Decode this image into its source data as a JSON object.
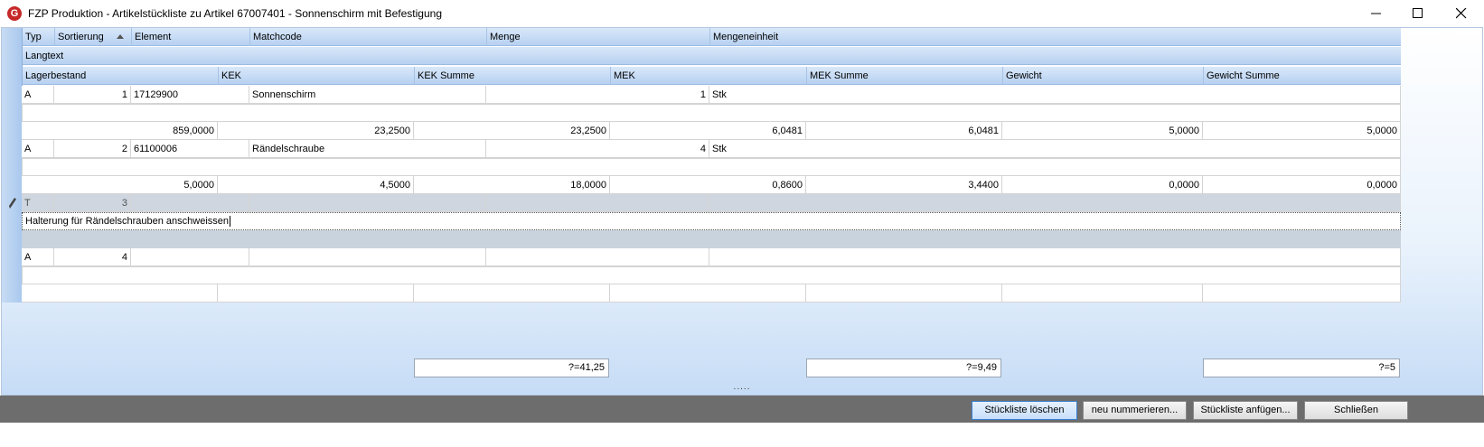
{
  "window": {
    "title": "FZP Produktion - Artikelstückliste zu Artikel 67007401  -  Sonnenschirm mit Befestigung",
    "icon_letter": "G"
  },
  "grid": {
    "header_row1": [
      "Typ",
      "Sortierung",
      "Element",
      "Matchcode",
      "Menge",
      "Mengeneinheit"
    ],
    "header_row2": [
      "Langtext"
    ],
    "header_row3": [
      "Lagerbestand",
      "KEK",
      "KEK Summe",
      "MEK",
      "MEK Summe",
      "Gewicht",
      "Gewicht Summe"
    ],
    "records": [
      {
        "typ": "A",
        "sortierung": "1",
        "element": "17129900",
        "matchcode": "Sonnenschirm",
        "menge": "1",
        "einheit": "Stk",
        "langtext": "",
        "lagerbestand": "859,0000",
        "kek": "23,2500",
        "kek_summe": "23,2500",
        "mek": "6,0481",
        "mek_summe": "6,0481",
        "gewicht": "5,0000",
        "gewicht_summe": "5,0000"
      },
      {
        "typ": "A",
        "sortierung": "2",
        "element": "61100006",
        "matchcode": "Rändelschraube",
        "menge": "4",
        "einheit": "Stk",
        "langtext": "",
        "lagerbestand": "5,0000",
        "kek": "4,5000",
        "kek_summe": "18,0000",
        "mek": "0,8600",
        "mek_summe": "3,4400",
        "gewicht": "0,0000",
        "gewicht_summe": "0,0000"
      },
      {
        "typ": "T",
        "sortierung": "3",
        "langtext": "Halterung für Rändelschrauben anschweissen"
      },
      {
        "typ": "A",
        "sortierung": "4"
      }
    ],
    "sums": {
      "kek_summe": "?=41,25",
      "mek_summe": "?=9,49",
      "gewicht_summe": "?=5"
    }
  },
  "splitter": ".....",
  "buttons": {
    "delete": "Stückliste löschen",
    "renumber": "neu nummerieren...",
    "append": "Stückliste anfügen...",
    "close": "Schließen"
  }
}
